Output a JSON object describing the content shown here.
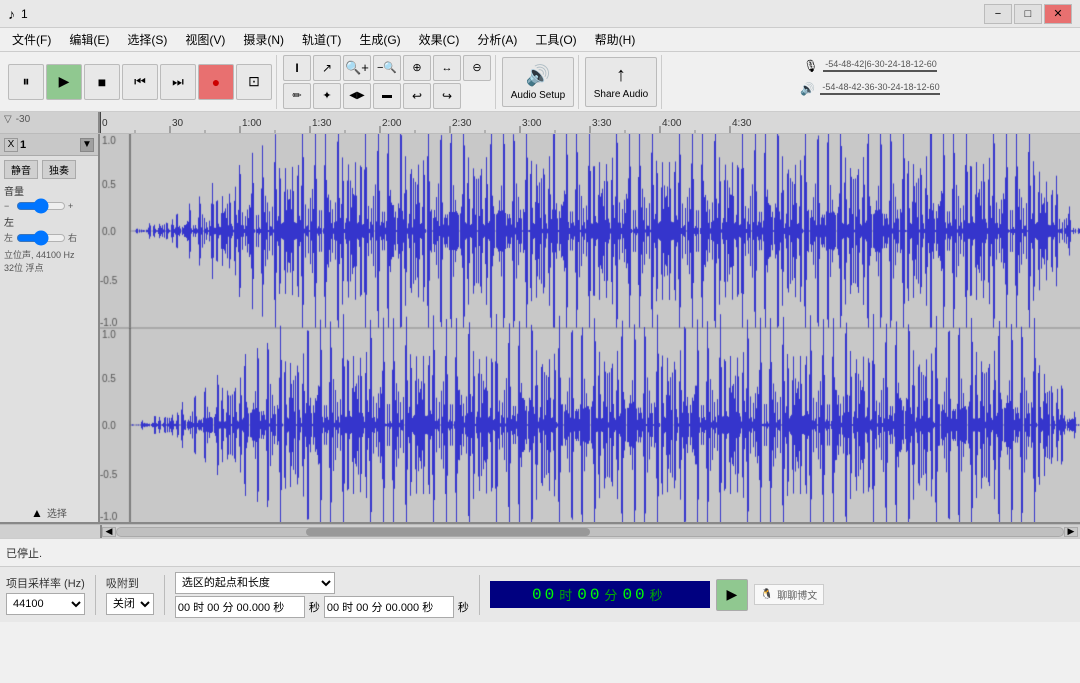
{
  "titlebar": {
    "title": "1",
    "app_icon": "♪",
    "minimize_label": "−",
    "maximize_label": "□",
    "close_label": "✕"
  },
  "menubar": {
    "items": [
      {
        "label": "文件(F)"
      },
      {
        "label": "编辑(E)"
      },
      {
        "label": "选择(S)"
      },
      {
        "label": "视图(V)"
      },
      {
        "label": "摄录(N)"
      },
      {
        "label": "轨道(T)"
      },
      {
        "label": "生成(G)"
      },
      {
        "label": "效果(C)"
      },
      {
        "label": "分析(A)"
      },
      {
        "label": "工具(O)"
      },
      {
        "label": "帮助(H)"
      }
    ]
  },
  "transport": {
    "pause_icon": "⏸",
    "play_icon": "▶",
    "stop_icon": "■",
    "prev_icon": "⏮",
    "next_icon": "⏭",
    "record_icon": "●",
    "loop_icon": "⊡"
  },
  "tools": {
    "select_icon": "I",
    "envelope_icon": "↗",
    "zoom_in_icon": "+",
    "zoom_out_icon": "−",
    "zoom_sel_icon": "⊕",
    "zoom_fit_icon": "↔",
    "zoom_out2_icon": "⊖",
    "draw_icon": "✏",
    "multi_icon": "✦",
    "trim_icon": "◀▶",
    "silence_icon": "▬",
    "undo_icon": "↩",
    "redo_icon": "↪"
  },
  "audio_setup": {
    "icon": "🔊",
    "label": "Audio Setup"
  },
  "share_audio": {
    "icon": "↑",
    "label": "Share Audio"
  },
  "track": {
    "number": "1",
    "close_label": "X",
    "mute_label": "静音",
    "solo_label": "独奏",
    "gain_label": "音量",
    "gain_minus": "−",
    "gain_plus": "+",
    "pan_label": "左",
    "pan_right": "右",
    "info_line1": "立位声, 44100 Hz",
    "info_line2": "32位 浮点",
    "collapse_icon": "▲",
    "select_label": "选择"
  },
  "ruler": {
    "start": "-30",
    "marks": [
      "0",
      "30",
      "1:00",
      "1:30",
      "2:00",
      "2:30",
      "3:00",
      "3:30",
      "4:00",
      "4:30"
    ]
  },
  "status": {
    "text": "已停止."
  },
  "bottom": {
    "sample_rate_label": "项目采样率 (Hz)",
    "sample_rate_value": "44100",
    "snap_label": "吸附到",
    "snap_value": "关闭",
    "region_label": "选区的起点和长度",
    "start_time": "00 时 00 分 00.000 秒",
    "end_time": "00 时 00 分 00.000 秒",
    "time_display": {
      "hours": "00",
      "mins": "00",
      "secs": "00"
    },
    "play_icon": "▶",
    "qq_text": "聊聊博文"
  },
  "vu_meter": {
    "rec_icon": "🎙",
    "play_icon": "🔊",
    "scale_labels": [
      "-54",
      "-48",
      "-42",
      "-36",
      "-30",
      "-24",
      "-18",
      "-12",
      "-6",
      "0"
    ]
  }
}
